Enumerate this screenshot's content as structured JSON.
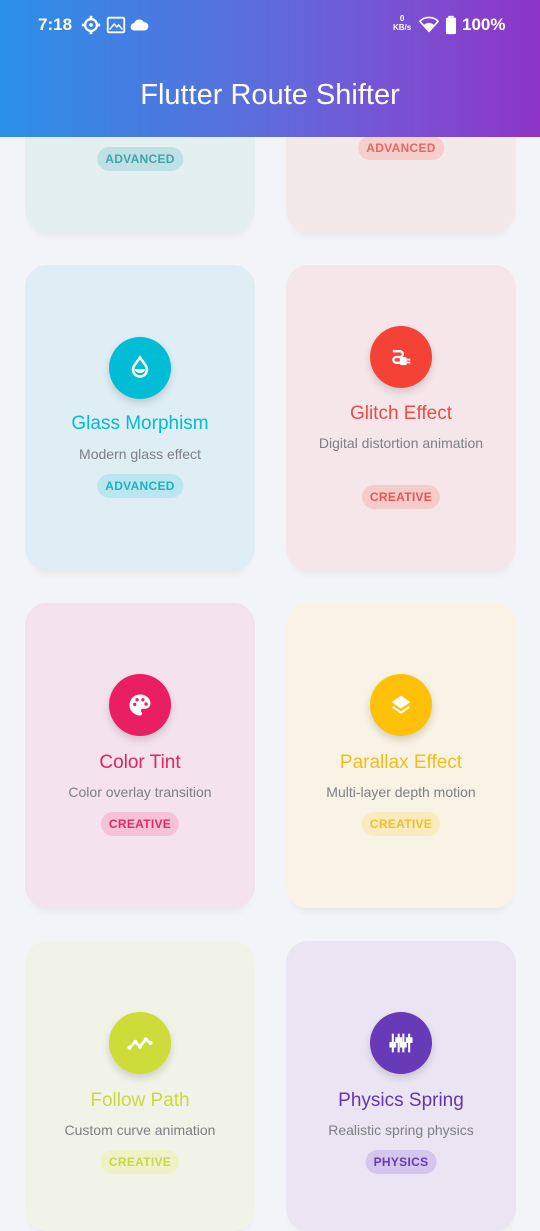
{
  "status_bar": {
    "time": "7:18",
    "net_speed_value": "0",
    "net_speed_unit": "KB/s",
    "battery_percent": "100%"
  },
  "app_bar": {
    "title": "Flutter Route Shifter"
  },
  "cards": [
    {
      "title": "",
      "description": "",
      "badge": "ADVANCED",
      "accent": "#00b8cc"
    },
    {
      "title": "",
      "description": "",
      "badge": "ADVANCED",
      "accent": "#f04e44"
    },
    {
      "title": "Glass Morphism",
      "description": "Modern glass effect",
      "badge": "ADVANCED",
      "accent": "#00bcd4",
      "icon": "water-drop-icon"
    },
    {
      "title": "Glitch Effect",
      "description": "Digital distortion animation",
      "badge": "CREATIVE",
      "accent": "#f44336",
      "icon": "plug-icon"
    },
    {
      "title": "Color Tint",
      "description": "Color overlay transition",
      "badge": "CREATIVE",
      "accent": "#e91e63",
      "icon": "palette-icon"
    },
    {
      "title": "Parallax Effect",
      "description": "Multi-layer depth motion",
      "badge": "CREATIVE",
      "accent": "#ffc107",
      "icon": "layers-icon"
    },
    {
      "title": "Follow Path",
      "description": "Custom curve animation",
      "badge": "CREATIVE",
      "accent": "#cddc39",
      "icon": "path-icon"
    },
    {
      "title": "Physics Spring",
      "description": "Realistic spring physics",
      "badge": "PHYSICS",
      "accent": "#673ab7",
      "icon": "sliders-icon"
    }
  ]
}
